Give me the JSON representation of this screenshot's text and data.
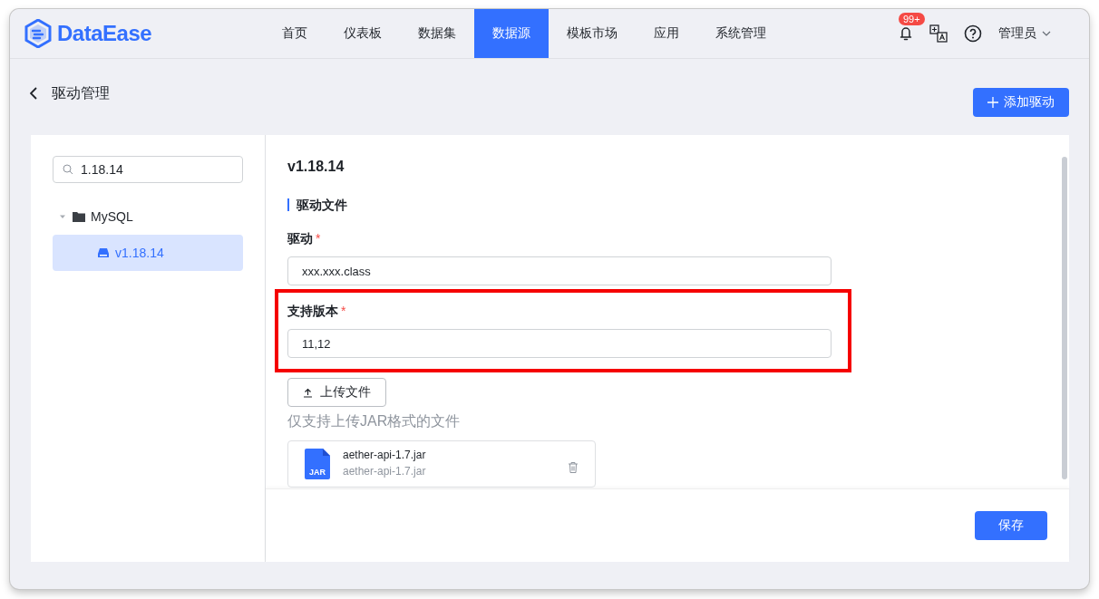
{
  "header": {
    "logo": "DataEase",
    "nav": [
      {
        "label": "首页",
        "selected": false
      },
      {
        "label": "仪表板",
        "selected": false
      },
      {
        "label": "数据集",
        "selected": false
      },
      {
        "label": "数据源",
        "selected": true
      },
      {
        "label": "模板市场",
        "selected": false
      },
      {
        "label": "应用",
        "selected": false
      },
      {
        "label": "系统管理",
        "selected": false
      }
    ],
    "notification_badge": "99+",
    "user": "管理员"
  },
  "page": {
    "title": "驱动管理",
    "add_button": "添加驱动"
  },
  "sidebar": {
    "search": {
      "value": "1.18.14"
    },
    "tree": [
      {
        "label": "MySQL",
        "expanded": true,
        "children": [
          {
            "label": "v1.18.14",
            "selected": true
          }
        ]
      }
    ]
  },
  "form": {
    "title": "v1.18.14",
    "section": "驱动文件",
    "fields": [
      {
        "label": "驱动",
        "required": true,
        "required_mark": "*",
        "value": "xxx.xxx.class",
        "highlighted": false
      },
      {
        "label": "支持版本",
        "required": true,
        "required_mark": "*",
        "value": "11,12",
        "highlighted": true
      }
    ],
    "upload_button": "上传文件",
    "upload_hint": "仅支持上传JAR格式的文件",
    "files": [
      {
        "name": "aether-api-1.7.jar",
        "subtitle": "aether-api-1.7.jar",
        "badge": "JAR"
      }
    ],
    "save_button": "保存"
  }
}
